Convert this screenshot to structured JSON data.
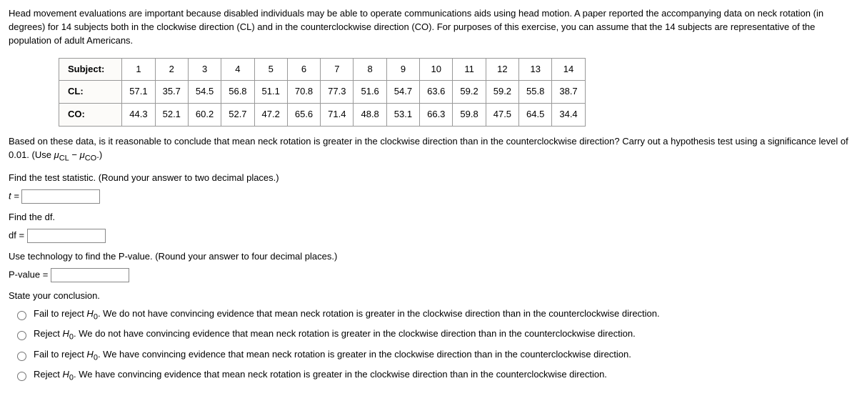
{
  "intro": "Head movement evaluations are important because disabled individuals may be able to operate communications aids using head motion. A paper reported the accompanying data on neck rotation (in degrees) for 14 subjects both in the clockwise direction (CL) and in the counterclockwise direction (CO). For purposes of this exercise, you can assume that the 14 subjects are representative of the population of adult Americans.",
  "table": {
    "header_label": "Subject:",
    "subjects": [
      "1",
      "2",
      "3",
      "4",
      "5",
      "6",
      "7",
      "8",
      "9",
      "10",
      "11",
      "12",
      "13",
      "14"
    ],
    "cl_label": "CL:",
    "cl_values": [
      "57.1",
      "35.7",
      "54.5",
      "56.8",
      "51.1",
      "70.8",
      "77.3",
      "51.6",
      "54.7",
      "63.6",
      "59.2",
      "59.2",
      "55.8",
      "38.7"
    ],
    "co_label": "CO:",
    "co_values": [
      "44.3",
      "52.1",
      "60.2",
      "52.7",
      "47.2",
      "65.6",
      "71.4",
      "48.8",
      "53.1",
      "66.3",
      "59.8",
      "47.5",
      "64.5",
      "34.4"
    ]
  },
  "question_prefix": "Based on these data, is it reasonable to conclude that mean neck rotation is greater in the clockwise direction than in the counterclockwise direction? Carry out a hypothesis test using a significance level of 0.01. (Use ",
  "mu_cl": "μ",
  "mu_cl_sub": "CL",
  "minus": " − ",
  "mu_co": "μ",
  "mu_co_sub": "CO",
  "question_suffix": ".)",
  "find_stat": "Find the test statistic. (Round your answer to two decimal places.)",
  "t_label": "t = ",
  "find_df": "Find the df.",
  "df_label": "df = ",
  "find_p": "Use technology to find the P-value. (Round your answer to four decimal places.)",
  "p_label": "P-value = ",
  "state_conclusion": "State your conclusion.",
  "choices": [
    {
      "pre": "Fail to reject ",
      "h": "H",
      "sub": "0",
      "post": ". We do not have convincing evidence that mean neck rotation is greater in the clockwise direction than in the counterclockwise direction."
    },
    {
      "pre": "Reject ",
      "h": "H",
      "sub": "0",
      "post": ". We do not have convincing evidence that mean neck rotation is greater in the clockwise direction than in the counterclockwise direction."
    },
    {
      "pre": "Fail to reject ",
      "h": "H",
      "sub": "0",
      "post": ". We have convincing evidence that mean neck rotation is greater in the clockwise direction than in the counterclockwise direction."
    },
    {
      "pre": "Reject ",
      "h": "H",
      "sub": "0",
      "post": ". We have convincing evidence that mean neck rotation is greater in the clockwise direction than in the counterclockwise direction."
    }
  ]
}
